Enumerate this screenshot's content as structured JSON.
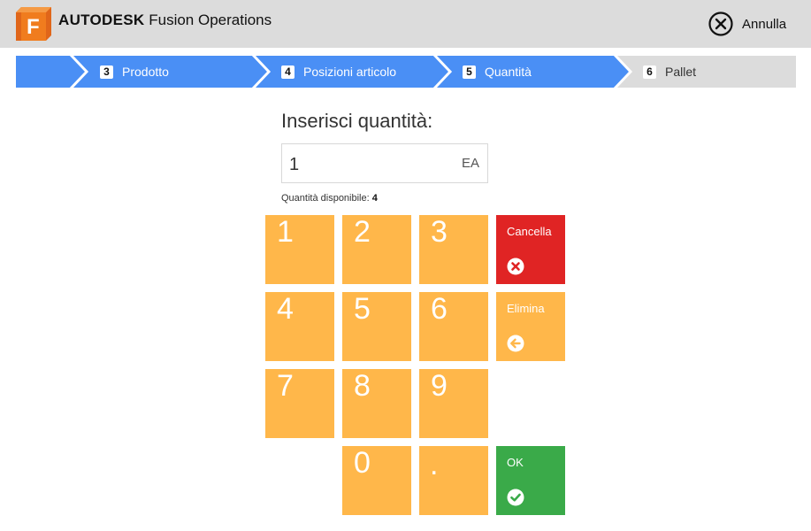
{
  "header": {
    "logo_letter": "F",
    "brand_bold": "AUTODESK",
    "brand_product": "Fusion Operations",
    "cancel_label": "Annulla"
  },
  "stepper": {
    "steps": [
      {
        "number": "3",
        "label": "Prodotto",
        "state": "done"
      },
      {
        "number": "4",
        "label": "Posizioni articolo",
        "state": "done"
      },
      {
        "number": "5",
        "label": "Quantità",
        "state": "current"
      },
      {
        "number": "6",
        "label": "Pallet",
        "state": "upcoming"
      }
    ]
  },
  "form": {
    "title": "Inserisci quantità:",
    "quantity_value": "1",
    "unit": "EA",
    "available_label": "Quantità disponibile:",
    "available_value": "4"
  },
  "keypad": {
    "keys": [
      "1",
      "2",
      "3",
      "4",
      "5",
      "6",
      "7",
      "8",
      "9",
      "0",
      "."
    ],
    "clear_label": "Cancella",
    "backspace_label": "Elimina",
    "ok_label": "OK"
  },
  "colors": {
    "header_bg": "#dcdcdc",
    "step_active": "#4a8ff5",
    "step_inactive": "#dcdcdc",
    "key": "#ffb74a",
    "clear": "#e02424",
    "ok": "#3aaa49",
    "logo": "#f07c1e"
  }
}
